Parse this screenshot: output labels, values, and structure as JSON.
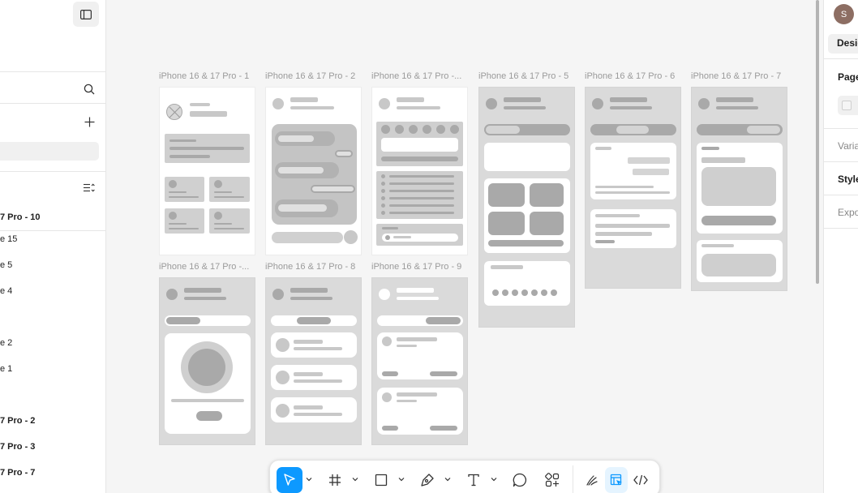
{
  "left_panel": {
    "layers": [
      {
        "label": "7 Pro - 10",
        "bold": true
      },
      {
        "label": "e 15",
        "bold": false
      },
      {
        "label": "e 5",
        "bold": false
      },
      {
        "label": "e 4",
        "bold": false
      },
      {
        "label": "e 2",
        "bold": false
      },
      {
        "label": "e 1",
        "bold": false
      },
      {
        "label": "7 Pro - 2",
        "bold": true
      },
      {
        "label": "7 Pro - 3",
        "bold": true
      },
      {
        "label": "7 Pro - 7",
        "bold": true
      }
    ]
  },
  "canvas": {
    "frames": [
      {
        "label": "iPhone 16 & 17 Pro - 1"
      },
      {
        "label": "iPhone 16 & 17 Pro - 2"
      },
      {
        "label": "iPhone 16 & 17 Pro -..."
      },
      {
        "label": "iPhone 16 & 17 Pro - 5"
      },
      {
        "label": "iPhone 16 & 17 Pro - 6"
      },
      {
        "label": "iPhone 16 & 17 Pro - 7"
      },
      {
        "label": "iPhone 16 & 17 Pro -..."
      },
      {
        "label": "iPhone 16 & 17 Pro - 8"
      },
      {
        "label": "iPhone 16 & 17 Pro - 9"
      }
    ]
  },
  "right_panel": {
    "avatar_initial": "S",
    "design_tab": "Desig",
    "section_page": "Page",
    "section_variables": "Varia",
    "section_styles": "Style",
    "section_export": "Expo"
  },
  "toolbar": {
    "tools": [
      "move-tool",
      "frame-tool",
      "shape-tool",
      "pen-tool",
      "text-tool",
      "comment-tool",
      "actions-tool",
      "draw-mode",
      "design-mode",
      "dev-mode"
    ],
    "accent": "#0d99ff"
  }
}
